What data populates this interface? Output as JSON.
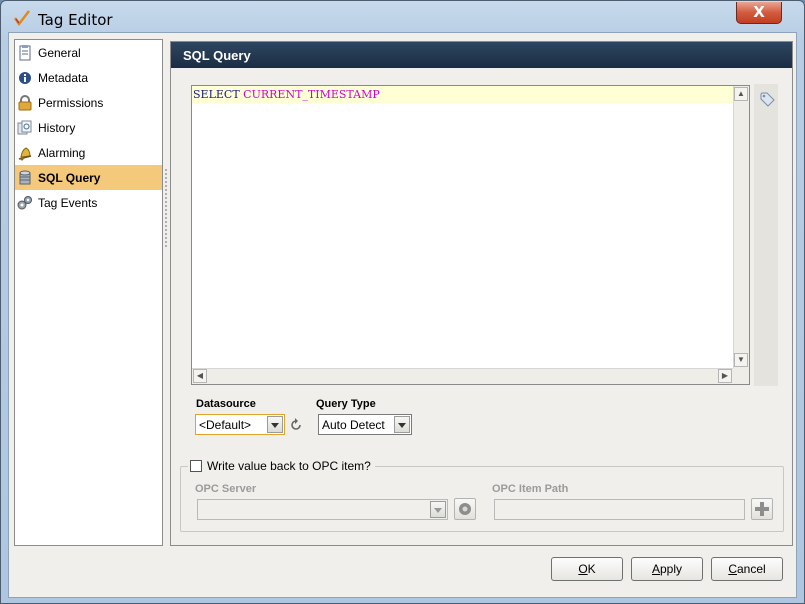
{
  "window": {
    "title": "Tag Editor",
    "close_glyph": "X"
  },
  "sidebar": {
    "items": [
      {
        "label": "General",
        "icon": "document-icon"
      },
      {
        "label": "Metadata",
        "icon": "info-icon"
      },
      {
        "label": "Permissions",
        "icon": "lock-icon"
      },
      {
        "label": "History",
        "icon": "history-icon"
      },
      {
        "label": "Alarming",
        "icon": "bell-icon"
      },
      {
        "label": "SQL Query",
        "icon": "database-icon",
        "selected": true
      },
      {
        "label": "Tag Events",
        "icon": "gears-icon"
      }
    ]
  },
  "panel": {
    "title": "SQL Query",
    "editor": {
      "keyword": "SELECT",
      "function": "CURRENT_TIMESTAMP"
    },
    "datasource": {
      "label": "Datasource",
      "value": "<Default>"
    },
    "query_type": {
      "label": "Query Type",
      "value": "Auto Detect"
    },
    "write_back": {
      "label": "Write value back to OPC item?",
      "checked": false,
      "opc_server_label": "OPC Server",
      "opc_item_path_label": "OPC Item Path"
    }
  },
  "buttons": {
    "ok": {
      "mnemonic": "O",
      "rest": "K"
    },
    "apply": {
      "mnemonic": "A",
      "rest": "pply"
    },
    "cancel": {
      "mnemonic": "C",
      "rest": "ancel"
    }
  },
  "colors": {
    "header_bg": "#233850",
    "selected_item": "#f4c97c",
    "current_line": "#ffffd6"
  }
}
